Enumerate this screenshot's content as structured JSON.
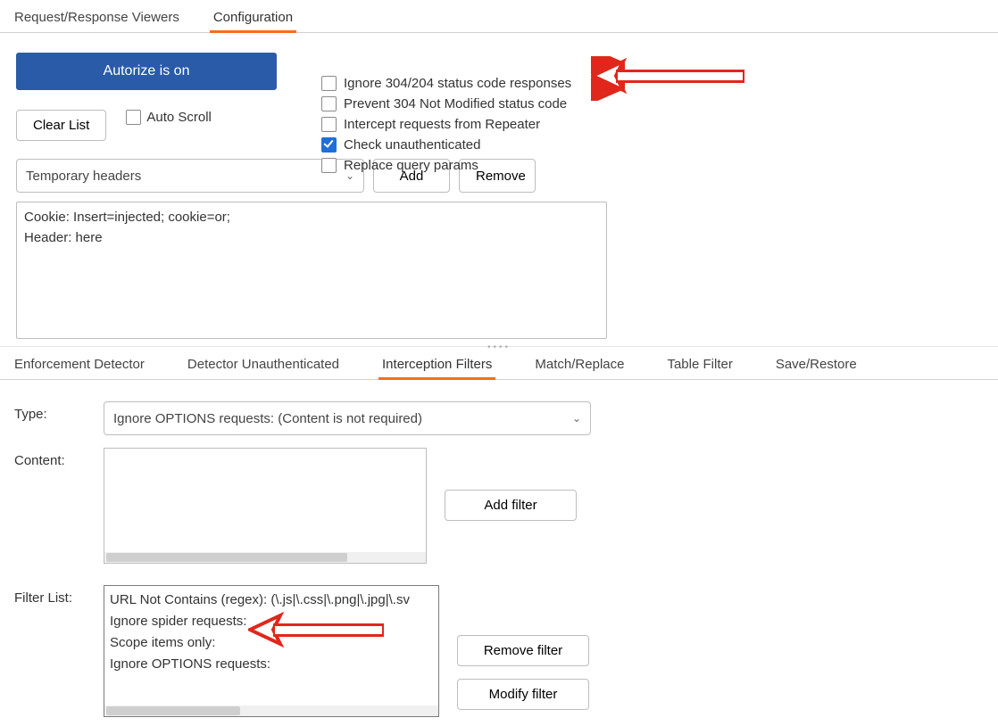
{
  "top_tabs": {
    "req_resp": "Request/Response Viewers",
    "configuration": "Configuration"
  },
  "autorize_btn": "Autorize is on",
  "clear_list_btn": "Clear List",
  "auto_scroll_label": "Auto Scroll",
  "options": {
    "ignore_304_204": {
      "label": "Ignore 304/204 status code responses",
      "checked": false
    },
    "prevent_304": {
      "label": "Prevent 304 Not Modified status code",
      "checked": false
    },
    "intercept_repeater": {
      "label": "Intercept requests from Repeater",
      "checked": false
    },
    "check_unauth": {
      "label": "Check unauthenticated",
      "checked": true
    },
    "replace_query": {
      "label": "Replace query params",
      "checked": false
    }
  },
  "header_select": "Temporary headers",
  "add_btn": "Add",
  "remove_btn": "Remove",
  "headers_text": "Cookie: Insert=injected; cookie=or;\nHeader: here",
  "lower_tabs": {
    "enforcement": "Enforcement Detector",
    "detector_unauth": "Detector Unauthenticated",
    "interception": "Interception Filters",
    "match_replace": "Match/Replace",
    "table_filter": "Table Filter",
    "save_restore": "Save/Restore"
  },
  "type_label": "Type:",
  "type_select_value": "Ignore OPTIONS requests: (Content is not required)",
  "content_label": "Content:",
  "add_filter_btn": "Add filter",
  "filter_list_label": "Filter List:",
  "filter_list": {
    "0": "URL Not Contains (regex): (\\.js|\\.css|\\.png|\\.jpg|\\.sv",
    "1": "Ignore spider requests:",
    "2": "Scope items only:",
    "3": "Ignore OPTIONS requests:"
  },
  "remove_filter_btn": "Remove filter",
  "modify_filter_btn": "Modify filter"
}
